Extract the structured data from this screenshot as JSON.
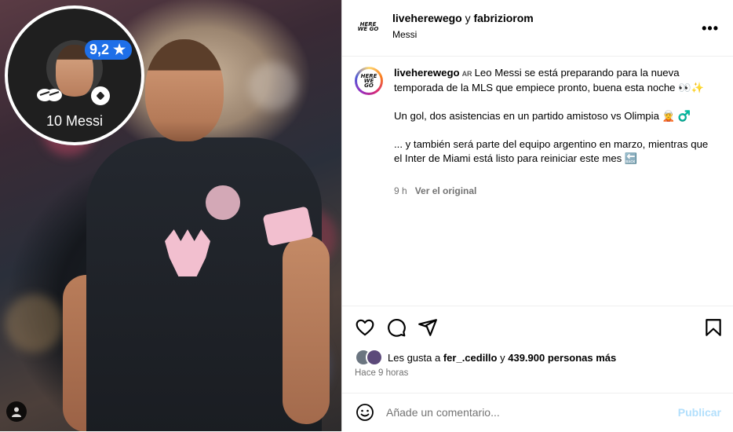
{
  "media": {
    "rating": "9,2 ★",
    "player_label": "10 Messi"
  },
  "header": {
    "user1": "liveherewego",
    "joiner": "y",
    "user2": "fabriziorom",
    "subtitle": "Messi",
    "logo_text": "HERE WE GO"
  },
  "caption": {
    "user": "liveherewego",
    "region": "AR",
    "p1": "Leo Messi se está preparando para la nueva temporada de la MLS que empiece pronto, buena esta noche 👀✨",
    "p2": "Un gol, dos asistencias en un partido amistoso vs Olimpia 🧝 ♂️",
    "p3": "... y también será parte del equipo argentino en marzo, mientras que el Inter de Miami está listo para reiniciar este mes 🔙",
    "time": "9 h",
    "see_original": "Ver el original"
  },
  "likes": {
    "prefix": "Les gusta a",
    "user": "fer_.cedillo",
    "and": "y",
    "count": "439.900 personas más"
  },
  "ago": "Hace 9 horas",
  "comment": {
    "placeholder": "Añade un comentario...",
    "publish": "Publicar"
  }
}
